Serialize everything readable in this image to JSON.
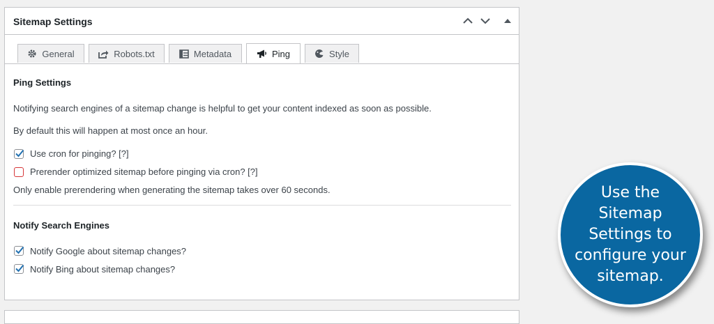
{
  "panel": {
    "title": "Sitemap Settings"
  },
  "header_buttons": {
    "move_up_icon": "chevron-up-icon",
    "move_down_icon": "chevron-down-icon",
    "toggle_icon": "triangle-up-icon"
  },
  "tabs": [
    {
      "label": "General",
      "icon": "gear-icon",
      "active": false
    },
    {
      "label": "Robots.txt",
      "icon": "share-icon",
      "active": false
    },
    {
      "label": "Metadata",
      "icon": "layout-icon",
      "active": false
    },
    {
      "label": "Ping",
      "icon": "megaphone-icon",
      "active": true
    },
    {
      "label": "Style",
      "icon": "palette-icon",
      "active": false
    }
  ],
  "ping": {
    "heading": "Ping Settings",
    "intro": "Notifying search engines of a sitemap change is helpful to get your content indexed as soon as possible.",
    "default_note": "By default this will happen at most once an hour.",
    "use_cron": {
      "label": "Use cron for pinging? [?]",
      "checked": true
    },
    "prerender": {
      "label": "Prerender optimized sitemap before pinging via cron? [?]",
      "checked": false
    },
    "prerender_note": "Only enable prerendering when generating the sitemap takes over 60 seconds."
  },
  "notify": {
    "heading": "Notify Search Engines",
    "google": {
      "label": "Notify Google about sitemap changes?",
      "checked": true
    },
    "bing": {
      "label": "Notify Bing about sitemap changes?",
      "checked": true
    }
  },
  "callout": {
    "text": "Use the Sitemap Settings to configure your sitemap."
  },
  "colors": {
    "accent": "#0a67a1",
    "checkmark": "#2271b1",
    "error_border": "#d63638"
  }
}
